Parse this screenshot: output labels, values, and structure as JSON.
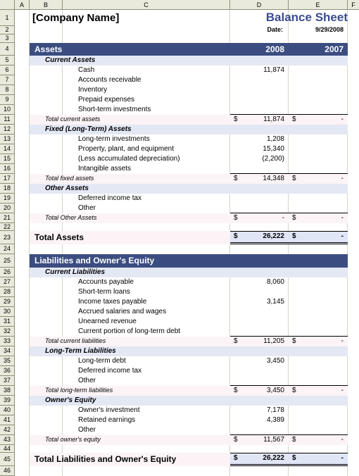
{
  "spreadsheet": {
    "column_headers": [
      "A",
      "B",
      "C",
      "D",
      "E",
      "F"
    ],
    "row_numbers": [
      "1",
      "2",
      "3",
      "4",
      "5",
      "6",
      "7",
      "8",
      "9",
      "10",
      "11",
      "12",
      "13",
      "14",
      "15",
      "16",
      "17",
      "18",
      "19",
      "20",
      "21",
      "22",
      "23",
      "24",
      "25",
      "26",
      "27",
      "28",
      "29",
      "30",
      "31",
      "32",
      "33",
      "34",
      "35",
      "36",
      "37",
      "38",
      "39",
      "40",
      "41",
      "42",
      "43",
      "44",
      "45",
      "46"
    ]
  },
  "header": {
    "company_name": "[Company Name]",
    "document_title": "Balance Sheet",
    "date_label": "Date:",
    "date_value": "9/29/2008"
  },
  "colors": {
    "band": "#3B4D80",
    "subband": "#E4E8F5",
    "title_blue": "#3B4D8F",
    "total_fill": "#E0E6F5",
    "label_fill": "#FBF3F5"
  },
  "assets": {
    "section_title": "Assets",
    "year_current": "2008",
    "year_prior": "2007",
    "groups": [
      {
        "title": "Current Assets",
        "items": [
          {
            "label": "Cash",
            "current": "11,874",
            "prior": ""
          },
          {
            "label": "Accounts receivable",
            "current": "",
            "prior": ""
          },
          {
            "label": "Inventory",
            "current": "",
            "prior": ""
          },
          {
            "label": "Prepaid expenses",
            "current": "",
            "prior": ""
          },
          {
            "label": "Short-term investments",
            "current": "",
            "prior": ""
          }
        ],
        "total": {
          "label": "Total current assets",
          "dollar": "$",
          "current": "11,874",
          "prior": "-"
        }
      },
      {
        "title": "Fixed (Long-Term) Assets",
        "items": [
          {
            "label": "Long-term investments",
            "current": "1,208",
            "prior": ""
          },
          {
            "label": "Property, plant, and equipment",
            "current": "15,340",
            "prior": ""
          },
          {
            "label": "(Less accumulated depreciation)",
            "current": "(2,200)",
            "prior": ""
          },
          {
            "label": "Intangible assets",
            "current": "",
            "prior": ""
          }
        ],
        "total": {
          "label": "Total fixed assets",
          "dollar": "$",
          "current": "14,348",
          "prior": "-"
        }
      },
      {
        "title": "Other Assets",
        "items": [
          {
            "label": "Deferred income tax",
            "current": "",
            "prior": ""
          },
          {
            "label": "Other",
            "current": "",
            "prior": ""
          }
        ],
        "total": {
          "label": "Total Other Assets",
          "dollar": "$",
          "current": "-",
          "prior": "-"
        }
      }
    ],
    "grand_total": {
      "label": "Total Assets",
      "dollar": "$",
      "current": "26,222",
      "prior": "-"
    }
  },
  "liabilities": {
    "section_title": "Liabilities and Owner's Equity",
    "groups": [
      {
        "title": "Current Liabilities",
        "items": [
          {
            "label": "Accounts payable",
            "current": "8,060",
            "prior": ""
          },
          {
            "label": "Short-term loans",
            "current": "",
            "prior": ""
          },
          {
            "label": "Income taxes payable",
            "current": "3,145",
            "prior": ""
          },
          {
            "label": "Accrued salaries and wages",
            "current": "",
            "prior": ""
          },
          {
            "label": "Unearned revenue",
            "current": "",
            "prior": ""
          },
          {
            "label": "Current portion of long-term debt",
            "current": "",
            "prior": ""
          }
        ],
        "total": {
          "label": "Total current liabilities",
          "dollar": "$",
          "current": "11,205",
          "prior": "-"
        }
      },
      {
        "title": "Long-Term Liabilities",
        "items": [
          {
            "label": "Long-term debt",
            "current": "3,450",
            "prior": ""
          },
          {
            "label": "Deferred income tax",
            "current": "",
            "prior": ""
          },
          {
            "label": "Other",
            "current": "",
            "prior": ""
          }
        ],
        "total": {
          "label": "Total long-term liabilities",
          "dollar": "$",
          "current": "3,450",
          "prior": "-"
        }
      },
      {
        "title": "Owner's Equity",
        "items": [
          {
            "label": "Owner's investment",
            "current": "7,178",
            "prior": ""
          },
          {
            "label": "Retained earnings",
            "current": "4,389",
            "prior": ""
          },
          {
            "label": "Other",
            "current": "",
            "prior": ""
          }
        ],
        "total": {
          "label": "Total owner's equity",
          "dollar": "$",
          "current": "11,567",
          "prior": "-"
        }
      }
    ],
    "grand_total": {
      "label": "Total Liabilities and Owner's Equity",
      "dollar": "$",
      "current": "26,222",
      "prior": "-"
    }
  }
}
